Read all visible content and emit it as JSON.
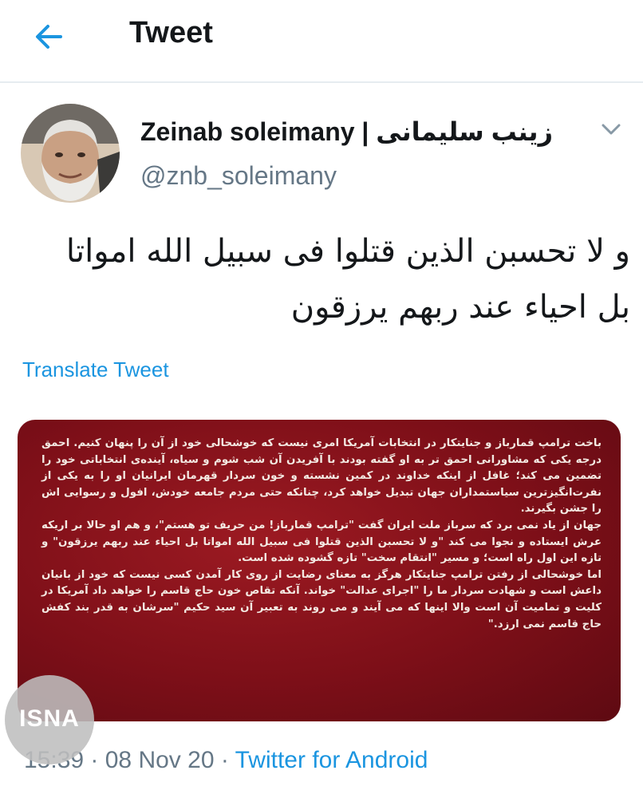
{
  "header": {
    "title": "Tweet"
  },
  "user": {
    "display_name": "Zeinab soleimany | زینب سلیمانی",
    "handle": "@znb_soleimany"
  },
  "tweet": {
    "text_line1": "و لا تحسبن الذین قتلوا فی سبیل الله امواتا",
    "text_line2": "بل احیاء عند ربهم یرزقون",
    "translate_label": "Translate Tweet",
    "image_paragraphs": [
      "باخت ترامپ قمارباز و جنایتکار در انتخابات آمریکا امری نیست که خوشحالی خود از آن را پنهان کنیم. احمق درجه یکی که مشاورانی احمق تر به او گفته بودند با آفریدن آن شب شوم و سیاه، آینده‌ی انتخاباتی خود را تضمین می کند؛ غافل از اینکه خداوند در کمین نشسته و خون سردار قهرمان ایرانیان او را به یکی از نفرت‌انگیزترین سیاستمداران جهان تبدیل خواهد کرد، چنانکه حتی مردم جامعه خودش، افول و رسوایی اش را جشن بگیرند.",
      "جهان از یاد نمی برد که سرباز ملت ایران گفت \"ترامپ قمارباز! من حریف تو هستم\"، و هم او حالا بر اریکه عرش ایستاده و نجوا می کند \"و لا تحسبن الذین قتلوا فی سبیل الله امواتا بل احیاء عند ربهم یرزقون\" و تازه این اول راه است؛ و مسیر \"انتقام سخت\" تازه گشوده شده است.",
      "اما خوشحالی از رفتن ترامپ جنایتکار هرگز به معنای رضایت از روی کار آمدن کسی نیست که خود از بانیان داعش است و شهادت سردار ما را \"اجرای عدالت\" خواند. آنکه تقاص خون حاج قاسم را خواهد داد آمریکا در کلیت و تمامیت آن است والا اینها که می آیند و می روند به تعبیر آن سید حکیم \"سرشان به قدر بند کفش حاج قاسم نمی ارزد.\""
    ]
  },
  "meta": {
    "time": "15:39",
    "separator": " · ",
    "date": "08 Nov 20",
    "source": "Twitter for Android"
  },
  "watermark": {
    "text": "ISNA"
  },
  "colors": {
    "link": "#1b95e0",
    "secondary": "#657786",
    "card_red": "#7d0f18"
  }
}
